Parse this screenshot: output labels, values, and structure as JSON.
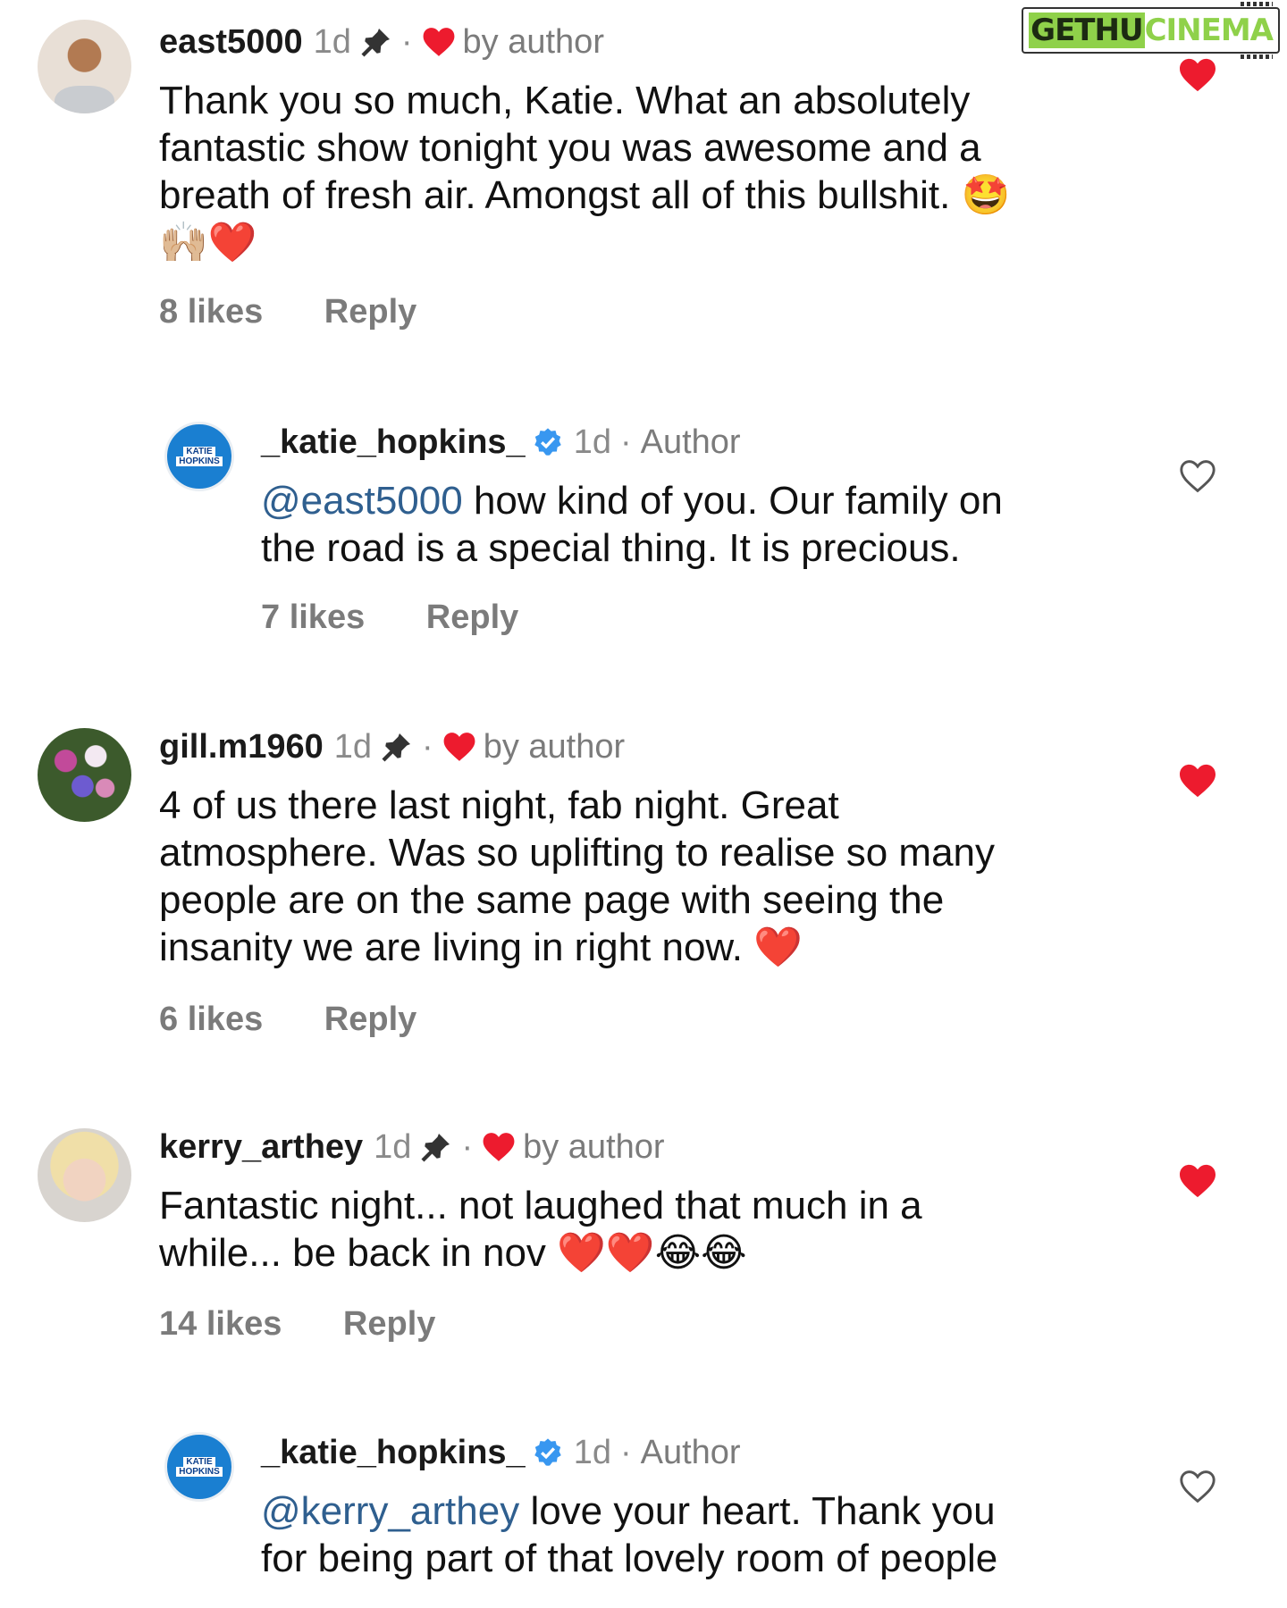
{
  "watermark": {
    "part1": "GETHU",
    "part2": "CINEMA"
  },
  "comments": [
    {
      "username": "east5000",
      "time": "1d",
      "by_author_label": "by author",
      "text_lines": [
        "Thank you so much, Katie. What an absolutely",
        "fantastic show tonight you was awesome and a",
        "breath of fresh air. Amongst all of this bullshit. 🤩",
        "🙌🏼❤️"
      ],
      "likes": "8 likes",
      "reply_label": "Reply",
      "liked": true
    },
    {
      "username": "_katie_hopkins_",
      "time": "1d",
      "author_label": "Author",
      "mention": "@east5000",
      "text_lines": [
        "how kind of you. Our family on",
        "the road is a special thing. It is precious."
      ],
      "likes": "7 likes",
      "reply_label": "Reply",
      "liked": false
    },
    {
      "username": "gill.m1960",
      "time": "1d",
      "by_author_label": "by author",
      "text_lines": [
        "4 of us there last night, fab night. Great",
        "atmosphere. Was so uplifting to realise so many",
        "people are on the same page with seeing the",
        "insanity we are living in right now. ❤️"
      ],
      "likes": "6 likes",
      "reply_label": "Reply",
      "liked": true
    },
    {
      "username": "kerry_arthey",
      "time": "1d",
      "by_author_label": "by author",
      "text_lines": [
        "Fantastic night... not laughed that much in a",
        "while... be back in nov ❤️❤️😂😂"
      ],
      "likes": "14 likes",
      "reply_label": "Reply",
      "liked": true
    },
    {
      "username": "_katie_hopkins_",
      "time": "1d",
      "author_label": "Author",
      "mention": "@kerry_arthey",
      "text_lines": [
        "love your heart. Thank you",
        "for being part of that lovely room of people"
      ],
      "liked": false
    }
  ],
  "avatar_text": {
    "line1": "KATIE",
    "line2": "HOPKINS"
  },
  "colors": {
    "heart": "#ed1b2e",
    "mention": "#2f5f8f",
    "verified": "#3897f0",
    "muted": "#7b7b7b"
  },
  "icons": {
    "pin": "pin-icon",
    "heart_filled": "heart-filled-icon",
    "heart_outline": "heart-outline-icon",
    "verified": "verified-badge-icon"
  }
}
